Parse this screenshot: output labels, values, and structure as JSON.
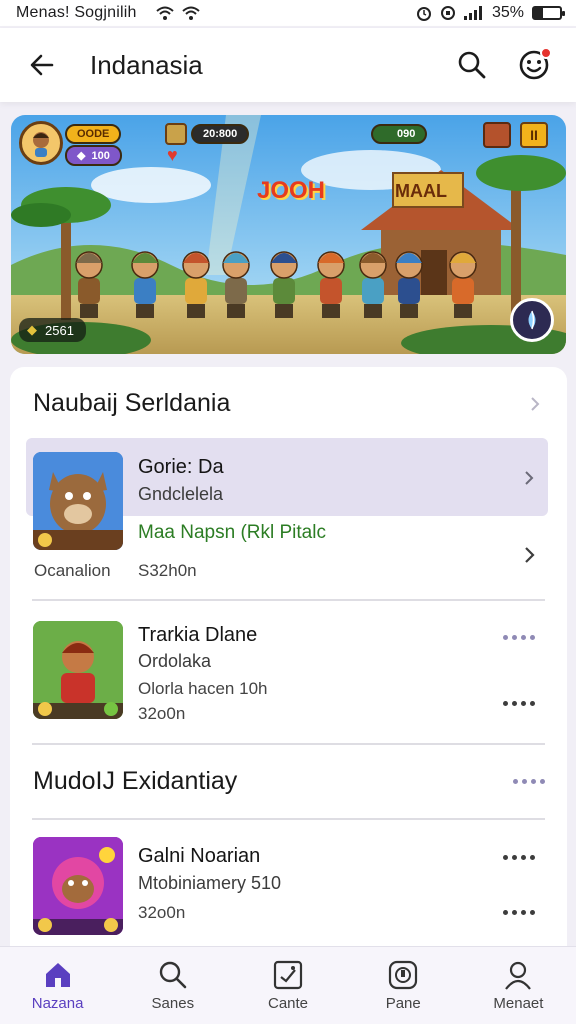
{
  "status_bar": {
    "carrier": "Menas! Sogjnilih",
    "battery": "35%",
    "battery_level": 0.35
  },
  "app_bar": {
    "title": "Indanasia"
  },
  "banner": {
    "coins": "OODE",
    "score": "20:800",
    "gems": "100",
    "energy": "090",
    "game_logo": "JOOH",
    "building_sign": "MAAL",
    "players": "2561"
  },
  "section1": {
    "title": "Naubaij Serldania"
  },
  "featured": {
    "name": "Gorie: Da",
    "subtitle": "Gndclelela",
    "highlight": "Maa Napsn (Rkl Pitalc",
    "category": "Ocanalion",
    "size": "S32h0n"
  },
  "apps": [
    {
      "name": "Trarkia Dlane",
      "subtitle": "Ordolaka",
      "detail": "Olorla hacen 10h",
      "size": "32o0n"
    },
    {
      "name": "Galni Noarian",
      "subtitle": "Mtobiniamery 510",
      "size": "32o0n"
    }
  ],
  "section2": {
    "title": "MudoIJ Exidantiay"
  },
  "nav": [
    {
      "label": "Nazana",
      "icon": "home-icon"
    },
    {
      "label": "Sanes",
      "icon": "search-icon"
    },
    {
      "label": "Cante",
      "icon": "game-icon"
    },
    {
      "label": "Pane",
      "icon": "pane-icon"
    },
    {
      "label": "Menaet",
      "icon": "profile-icon"
    }
  ],
  "colors": {
    "accent": "#5a3fc0",
    "highlight_row": "#e3dff0",
    "green_text": "#2c7d24",
    "notification": "#e5322d"
  }
}
